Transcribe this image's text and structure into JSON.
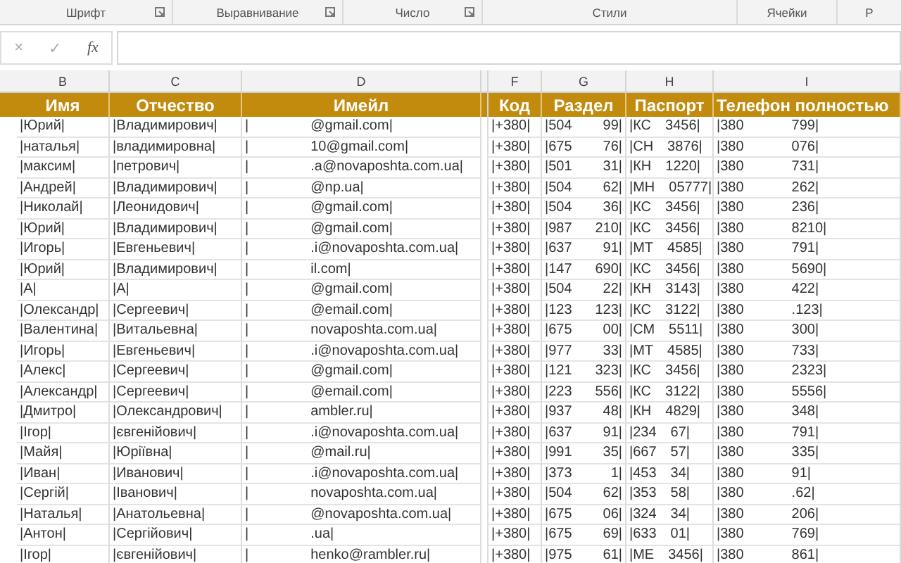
{
  "ribbon": {
    "groups": [
      {
        "label": "Шрифт",
        "launcher": true
      },
      {
        "label": "Выравнивание",
        "launcher": true
      },
      {
        "label": "Число",
        "launcher": true
      },
      {
        "label": "Стили",
        "launcher": false
      },
      {
        "label": "Ячейки",
        "launcher": false
      },
      {
        "label": "Р",
        "launcher": false
      }
    ]
  },
  "formula_bar": {
    "cancel": "×",
    "enter": "✓",
    "function": "fx"
  },
  "table": {
    "columns": [
      {
        "letter": "B",
        "heading": "Имя"
      },
      {
        "letter": "C",
        "heading": "Отчество"
      },
      {
        "letter": "D",
        "heading": "Имейл"
      },
      {
        "letter": "F",
        "heading": "Код"
      },
      {
        "letter": "G",
        "heading": "Раздел"
      },
      {
        "letter": "H",
        "heading": "Паспорт"
      },
      {
        "letter": "I",
        "heading": "Телефон полностью"
      }
    ],
    "rows": [
      {
        "name": "|Юрий|",
        "patronymic": "|Владимирович|",
        "email": [
          "|",
          "@gmail.com|"
        ],
        "code": "|+380|",
        "section": [
          "|504",
          "99|"
        ],
        "passport": [
          "|КС",
          "3456|"
        ],
        "phone": [
          "|380",
          "799|"
        ]
      },
      {
        "name": "|наталья|",
        "patronymic": "|владимировна|",
        "email": [
          "|",
          "10@gmail.com|"
        ],
        "code": "|+380|",
        "section": [
          "|675",
          "76|"
        ],
        "passport": [
          "|СН",
          "3876|"
        ],
        "phone": [
          "|380",
          "076|"
        ]
      },
      {
        "name": "|максим|",
        "patronymic": "|петрович|",
        "email": [
          "|",
          ".a@novaposhta.com.ua|"
        ],
        "code": "|+380|",
        "section": [
          "|501",
          "31|"
        ],
        "passport": [
          "|КН",
          "1220|"
        ],
        "phone": [
          "|380",
          "731|"
        ]
      },
      {
        "name": "|Андрей|",
        "patronymic": "|Владимирович|",
        "email": [
          "|",
          "@np.ua|"
        ],
        "code": "|+380|",
        "section": [
          "|504",
          "62|"
        ],
        "passport": [
          "|МН",
          "05777|"
        ],
        "phone": [
          "|380",
          "262|"
        ]
      },
      {
        "name": "|Николай|",
        "patronymic": "|Леонидович|",
        "email": [
          "|",
          "@gmail.com|"
        ],
        "code": "|+380|",
        "section": [
          "|504",
          "36|"
        ],
        "passport": [
          "|КС",
          "3456|"
        ],
        "phone": [
          "|380",
          "236|"
        ]
      },
      {
        "name": "|Юрий|",
        "patronymic": "|Владимирович|",
        "email": [
          "|",
          "@gmail.com|"
        ],
        "code": "|+380|",
        "section": [
          "|987",
          "210|"
        ],
        "passport": [
          "|КС",
          "3456|"
        ],
        "phone": [
          "|380",
          "8210|"
        ]
      },
      {
        "name": "|Игорь|",
        "patronymic": "|Евгеньевич|",
        "email": [
          "|",
          ".i@novaposhta.com.ua|"
        ],
        "code": "|+380|",
        "section": [
          "|637",
          "91|"
        ],
        "passport": [
          "|МТ",
          "4585|"
        ],
        "phone": [
          "|380",
          "791|"
        ]
      },
      {
        "name": "|Юрий|",
        "patronymic": "|Владимирович|",
        "email": [
          "|",
          "il.com|"
        ],
        "code": "|+380|",
        "section": [
          "|147",
          "690|"
        ],
        "passport": [
          "|КС",
          "3456|"
        ],
        "phone": [
          "|380",
          "5690|"
        ]
      },
      {
        "name": "|А|",
        "patronymic": "|А|",
        "email": [
          "|",
          "@gmail.com|"
        ],
        "code": "|+380|",
        "section": [
          "|504",
          "22|"
        ],
        "passport": [
          "|КН",
          "3143|"
        ],
        "phone": [
          "|380",
          "422|"
        ]
      },
      {
        "name": "|Олександр|",
        "patronymic": "|Сергеевич|",
        "email": [
          "|",
          "@email.com|"
        ],
        "code": "|+380|",
        "section": [
          "|123",
          "123|"
        ],
        "passport": [
          "|КС",
          "3122|"
        ],
        "phone": [
          "|380",
          ".123|"
        ]
      },
      {
        "name": "|Валентина|",
        "patronymic": "|Витальевна|",
        "email": [
          "|",
          "novaposhta.com.ua|"
        ],
        "code": "|+380|",
        "section": [
          "|675",
          "00|"
        ],
        "passport": [
          "|СМ",
          "5511|"
        ],
        "phone": [
          "|380",
          "300|"
        ]
      },
      {
        "name": "|Игорь|",
        "patronymic": "|Евгеньевич|",
        "email": [
          "|",
          ".i@novaposhta.com.ua|"
        ],
        "code": "|+380|",
        "section": [
          "|977",
          "33|"
        ],
        "passport": [
          "|МТ",
          "4585|"
        ],
        "phone": [
          "|380",
          "733|"
        ]
      },
      {
        "name": "|Алекс|",
        "patronymic": "|Сергеевич|",
        "email": [
          "|",
          "@gmail.com|"
        ],
        "code": "|+380|",
        "section": [
          "|121",
          "323|"
        ],
        "passport": [
          "|КС",
          "3456|"
        ],
        "phone": [
          "|380",
          "2323|"
        ]
      },
      {
        "name": "|Александр|",
        "patronymic": "|Сергеевич|",
        "email": [
          "|",
          "@email.com|"
        ],
        "code": "|+380|",
        "section": [
          "|223",
          "556|"
        ],
        "passport": [
          "|КС",
          "3122|"
        ],
        "phone": [
          "|380",
          "5556|"
        ]
      },
      {
        "name": "|Дмитро|",
        "patronymic": "|Олександрович|",
        "email": [
          "|",
          "ambler.ru|"
        ],
        "code": "|+380|",
        "section": [
          "|937",
          "48|"
        ],
        "passport": [
          "|КН",
          "4829|"
        ],
        "phone": [
          "|380",
          "348|"
        ]
      },
      {
        "name": "|Ігор|",
        "patronymic": "|євгенійович|",
        "email": [
          "|",
          ".i@novaposhta.com.ua|"
        ],
        "code": "|+380|",
        "section": [
          "|637",
          "91|"
        ],
        "passport": [
          "|234",
          "67|"
        ],
        "phone": [
          "|380",
          "791|"
        ]
      },
      {
        "name": "|Майя|",
        "patronymic": "|Юріївна|",
        "email": [
          "|",
          "@mail.ru|"
        ],
        "code": "|+380|",
        "section": [
          "|991",
          "35|"
        ],
        "passport": [
          "|667",
          "57|"
        ],
        "phone": [
          "|380",
          "335|"
        ]
      },
      {
        "name": "|Иван|",
        "patronymic": "|Иванович|",
        "email": [
          "|",
          ".i@novaposhta.com.ua|"
        ],
        "code": "|+380|",
        "section": [
          "|373",
          "1|"
        ],
        "passport": [
          "|453",
          "34|"
        ],
        "phone": [
          "|380",
          "91|"
        ]
      },
      {
        "name": "|Сергій|",
        "patronymic": "|Іванович|",
        "email": [
          "|",
          "novaposhta.com.ua|"
        ],
        "code": "|+380|",
        "section": [
          "|504",
          "62|"
        ],
        "passport": [
          "|353",
          "58|"
        ],
        "phone": [
          "|380",
          ".62|"
        ]
      },
      {
        "name": "|Наталья|",
        "patronymic": "|Анатольевна|",
        "email": [
          "|",
          "@novaposhta.com.ua|"
        ],
        "code": "|+380|",
        "section": [
          "|675",
          "06|"
        ],
        "passport": [
          "|324",
          "34|"
        ],
        "phone": [
          "|380",
          "206|"
        ]
      },
      {
        "name": "|Антон|",
        "patronymic": "|Сергійович|",
        "email": [
          "|",
          ".ua|"
        ],
        "code": "|+380|",
        "section": [
          "|675",
          "69|"
        ],
        "passport": [
          "|633",
          "01|"
        ],
        "phone": [
          "|380",
          "769|"
        ]
      },
      {
        "name": "|Ігор|",
        "patronymic": "|євгенійович|",
        "email": [
          "|",
          "henko@rambler.ru|"
        ],
        "code": "|+380|",
        "section": [
          "|975",
          "61|"
        ],
        "passport": [
          "|МЕ",
          "3456|"
        ],
        "phone": [
          "|380",
          "861|"
        ]
      }
    ]
  }
}
